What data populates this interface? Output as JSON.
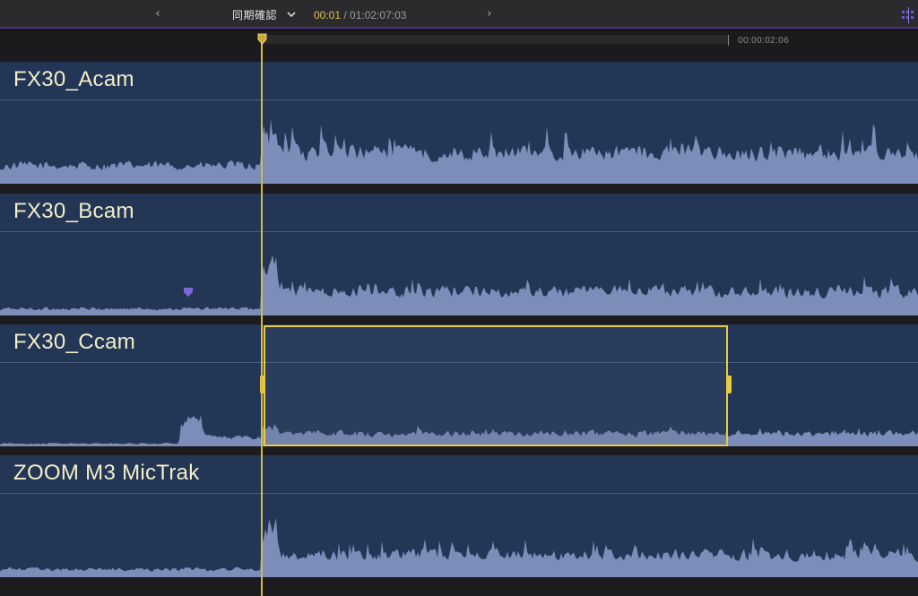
{
  "toolbar": {
    "prev_icon": "chevron-left-icon",
    "next_icon": "chevron-right-icon",
    "project_name": "同期確認",
    "project_menu_icon": "chevron-down-icon",
    "timecode_current": "00:01",
    "timecode_separator": " / ",
    "timecode_total": "01:02:07:03",
    "right_icon": "timeline-icon"
  },
  "ruler": {
    "range_end_timecode": "00:00:02:06"
  },
  "colors": {
    "track_bg": "#243656",
    "waveform": "#7b8db8",
    "playhead": "#d4b94a",
    "selection": "#ecc93e",
    "title": "#f2efc8",
    "accent": "#4e2f8c",
    "marker": "#7a6ad8"
  },
  "tracks": [
    {
      "name": "FX30_Acam"
    },
    {
      "name": "FX30_Bcam"
    },
    {
      "name": "FX30_Ccam"
    },
    {
      "name": "ZOOM M3 MicTrak"
    }
  ]
}
